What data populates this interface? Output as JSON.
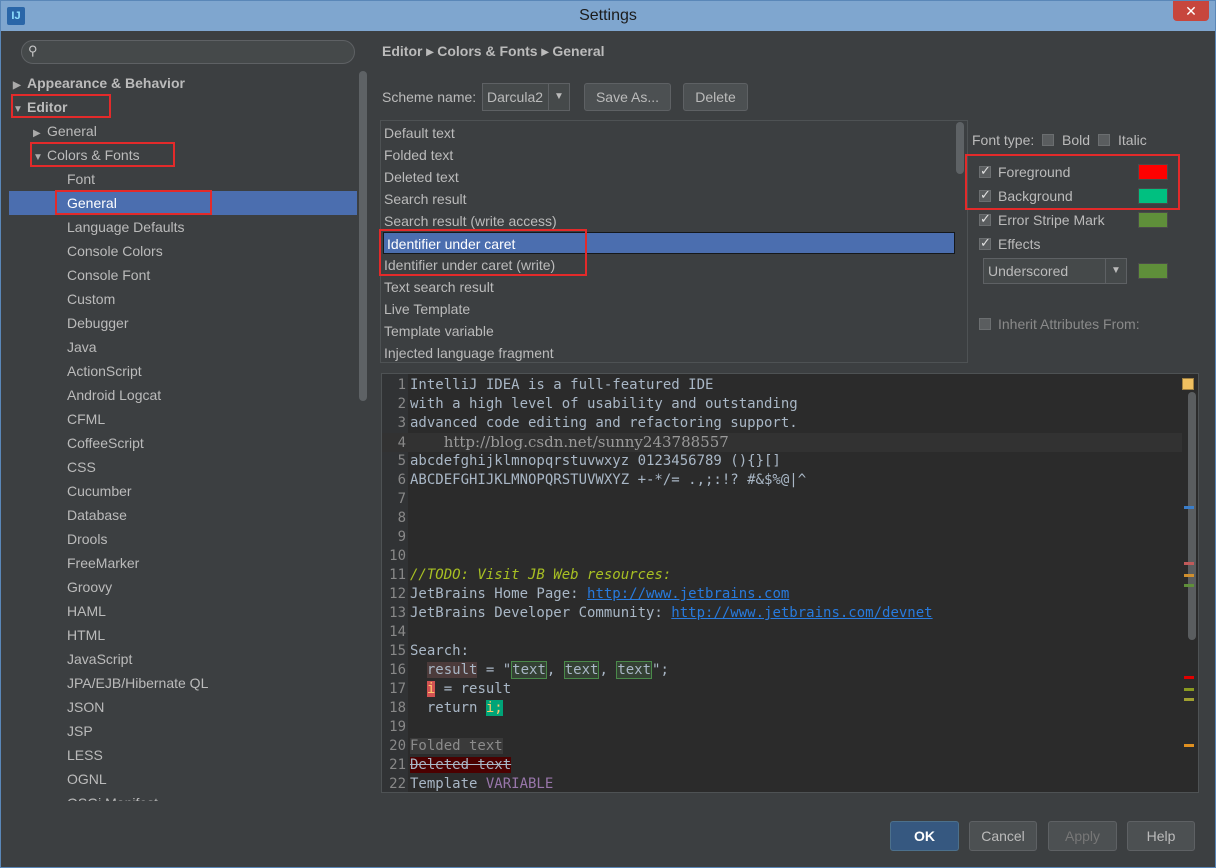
{
  "window": {
    "title": "Settings",
    "app_icon": "intellij-idea-icon",
    "close": "✕"
  },
  "search": {
    "placeholder": "",
    "icon": "search-icon"
  },
  "tree": [
    {
      "label": "Appearance & Behavior",
      "level": 0,
      "arrow": "▶",
      "bold": true
    },
    {
      "label": "Editor",
      "level": 0,
      "arrow": "▼",
      "bold": true
    },
    {
      "label": "General",
      "level": 1,
      "arrow": "▶"
    },
    {
      "label": "Colors & Fonts",
      "level": 1,
      "arrow": "▼"
    },
    {
      "label": "Font",
      "level": 2
    },
    {
      "label": "General",
      "level": 2,
      "selected": true
    },
    {
      "label": "Language Defaults",
      "level": 2
    },
    {
      "label": "Console Colors",
      "level": 2
    },
    {
      "label": "Console Font",
      "level": 2
    },
    {
      "label": "Custom",
      "level": 2
    },
    {
      "label": "Debugger",
      "level": 2
    },
    {
      "label": "Java",
      "level": 2
    },
    {
      "label": "ActionScript",
      "level": 2
    },
    {
      "label": "Android Logcat",
      "level": 2
    },
    {
      "label": "CFML",
      "level": 2
    },
    {
      "label": "CoffeeScript",
      "level": 2
    },
    {
      "label": "CSS",
      "level": 2
    },
    {
      "label": "Cucumber",
      "level": 2
    },
    {
      "label": "Database",
      "level": 2
    },
    {
      "label": "Drools",
      "level": 2
    },
    {
      "label": "FreeMarker",
      "level": 2
    },
    {
      "label": "Groovy",
      "level": 2
    },
    {
      "label": "HAML",
      "level": 2
    },
    {
      "label": "HTML",
      "level": 2
    },
    {
      "label": "JavaScript",
      "level": 2
    },
    {
      "label": "JPA/EJB/Hibernate QL",
      "level": 2
    },
    {
      "label": "JSON",
      "level": 2
    },
    {
      "label": "JSP",
      "level": 2
    },
    {
      "label": "LESS",
      "level": 2
    },
    {
      "label": "OGNL",
      "level": 2
    },
    {
      "label": "OSGi Manifest",
      "level": 2
    }
  ],
  "breadcrumb": "Editor ▸ Colors & Fonts ▸ General",
  "scheme": {
    "label": "Scheme name:",
    "value": "Darcula2",
    "save_as": "Save As...",
    "delete": "Delete"
  },
  "attributes": [
    "Default text",
    "Folded text",
    "Deleted text",
    "Search result",
    "Search result (write access)",
    "Identifier under caret",
    "Identifier under caret (write)",
    "Text search result",
    "Live Template",
    "Template variable",
    "Injected language fragment"
  ],
  "selected_attribute_index": 5,
  "options": {
    "font_type_label": "Font type:",
    "bold": "Bold",
    "italic": "Italic",
    "foreground": "Foreground",
    "background": "Background",
    "error_stripe": "Error Stripe Mark",
    "effects": "Effects",
    "effect_type": "Underscored",
    "inherit": "Inherit Attributes From:"
  },
  "colors": {
    "foreground": "#ff0000",
    "background": "#00c080",
    "error_stripe": "#5f8f3a",
    "effects": "#5f8f3a",
    "selection": "#4b6eaf",
    "annotation_box": "#e32a2a"
  },
  "preview": {
    "watermark": "http://blog.csdn.net/sunny243788557",
    "l1": "IntelliJ IDEA is a full-featured IDE",
    "l2": "with a high level of usability and outstanding",
    "l3": "advanced code editing and refactoring support.",
    "l5": "abcdefghijklmnopqrstuvwxyz 0123456789 (){}[]",
    "l6": "ABCDEFGHIJKLMNOPQRSTUVWXYZ +-*/= .,;:!? #&$%@|^",
    "l11": "//TODO: Visit JB Web resources:",
    "l12a": "JetBrains Home Page: ",
    "l12b": "http://www.jetbrains.com",
    "l13a": "JetBrains Developer Community: ",
    "l13b": "http://www.jetbrains.com/devnet",
    "l15": "Search:",
    "l16a": "  ",
    "l16b": "result",
    "l16c": " = \"",
    "l16d": "text",
    "l16e": ", ",
    "l16f": "text",
    "l16g": ", ",
    "l16h": "text",
    "l16i": "\";",
    "l17a": "  ",
    "l17b": "i",
    "l17c": " = result",
    "l18a": "  return ",
    "l18b": "i;",
    "l20": "Folded text",
    "l21": "Deleted text",
    "l22a": "Template ",
    "l22b": "VARIABLE"
  },
  "footer": {
    "ok": "OK",
    "cancel": "Cancel",
    "apply": "Apply",
    "help": "Help"
  }
}
